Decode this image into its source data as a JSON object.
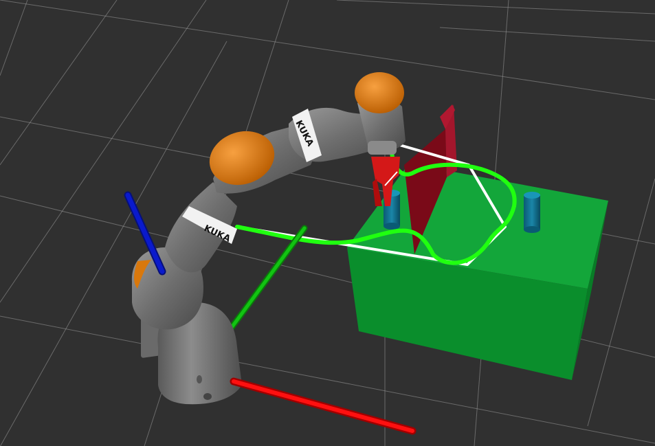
{
  "viewport": {
    "background": "#303030",
    "grid_color": "#9a9a9a"
  },
  "robot": {
    "brand_label_upper": "KUKA",
    "brand_label_lower": "KUKA",
    "link_color": "#7a7a7a",
    "joint_color": "#d9780c",
    "gripper_color": "#d41818"
  },
  "axes": {
    "x_color": "#ff1010",
    "y_color": "#10c010",
    "z_color": "#0a1acc"
  },
  "scene_objects": {
    "table_color": "#0a9a30",
    "wall_color": "#7a0a18",
    "cylinder_color": "#0a6a88"
  },
  "trajectory": {
    "planned_color": "#20ff10",
    "waypoint_path_color": "#ffffff"
  }
}
